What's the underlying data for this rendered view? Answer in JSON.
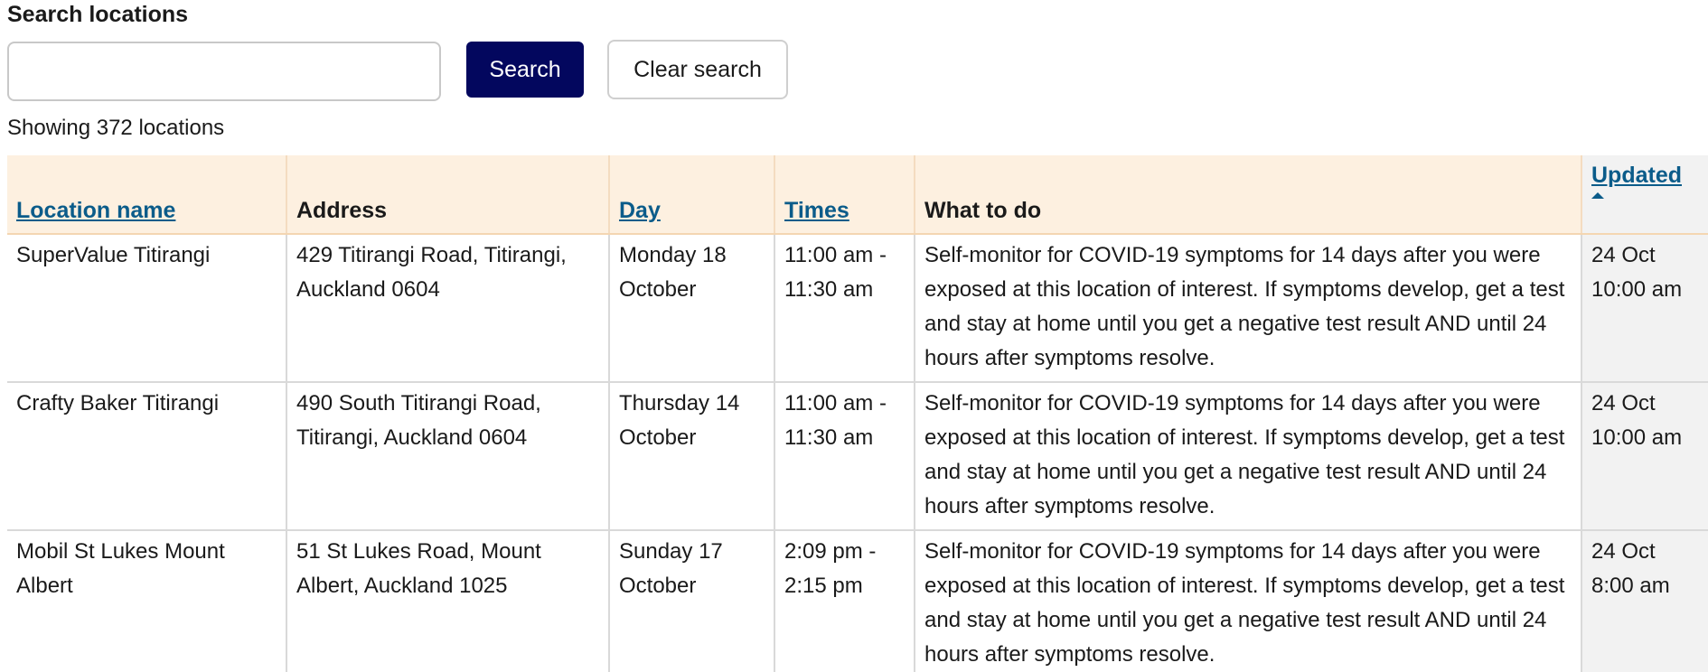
{
  "search": {
    "label": "Search locations",
    "value": "",
    "search_button": "Search",
    "clear_button": "Clear search"
  },
  "results": {
    "count_text": "Showing 372 locations"
  },
  "table": {
    "headers": {
      "location_name": "Location name",
      "address": "Address",
      "day": "Day",
      "times": "Times",
      "what_to_do": "What to do",
      "updated": "Updated"
    },
    "rows": [
      {
        "location_name": "SuperValue Titirangi",
        "address": "429 Titirangi Road, Titirangi, Auckland 0604",
        "day": "Monday 18 October",
        "times": "11:00 am - 11:30 am",
        "what_to_do": "Self-monitor for COVID-19 symptoms for 14 days after you were exposed at this location of interest. If symptoms develop, get a test and stay at home until you get a negative test result AND until 24 hours after symptoms resolve.",
        "updated": "24 Oct 10:00 am"
      },
      {
        "location_name": "Crafty Baker Titirangi",
        "address": "490 South Titirangi Road, Titirangi, Auckland 0604",
        "day": "Thursday 14 October",
        "times": "11:00 am - 11:30 am",
        "what_to_do": "Self-monitor for COVID-19 symptoms for 14 days after you were exposed at this location of interest. If symptoms develop, get a test and stay at home until you get a negative test result AND until 24 hours after symptoms resolve.",
        "updated": "24 Oct 10:00 am"
      },
      {
        "location_name": "Mobil St Lukes Mount Albert",
        "address": "51 St Lukes Road, Mount Albert, Auckland 1025",
        "day": "Sunday 17 October",
        "times": "2:09 pm - 2:15 pm",
        "what_to_do": "Self-monitor for COVID-19 symptoms for 14 days after you were exposed at this location of interest. If symptoms develop, get a test and stay at home until you get a negative test result AND until 24 hours after symptoms resolve.",
        "updated": "24 Oct 8:00 am"
      }
    ]
  },
  "colors": {
    "primary_button": "#03075e",
    "header_background": "#fdf0e0",
    "link": "#0b5c8a",
    "updated_column_background": "#f2f2f2"
  }
}
